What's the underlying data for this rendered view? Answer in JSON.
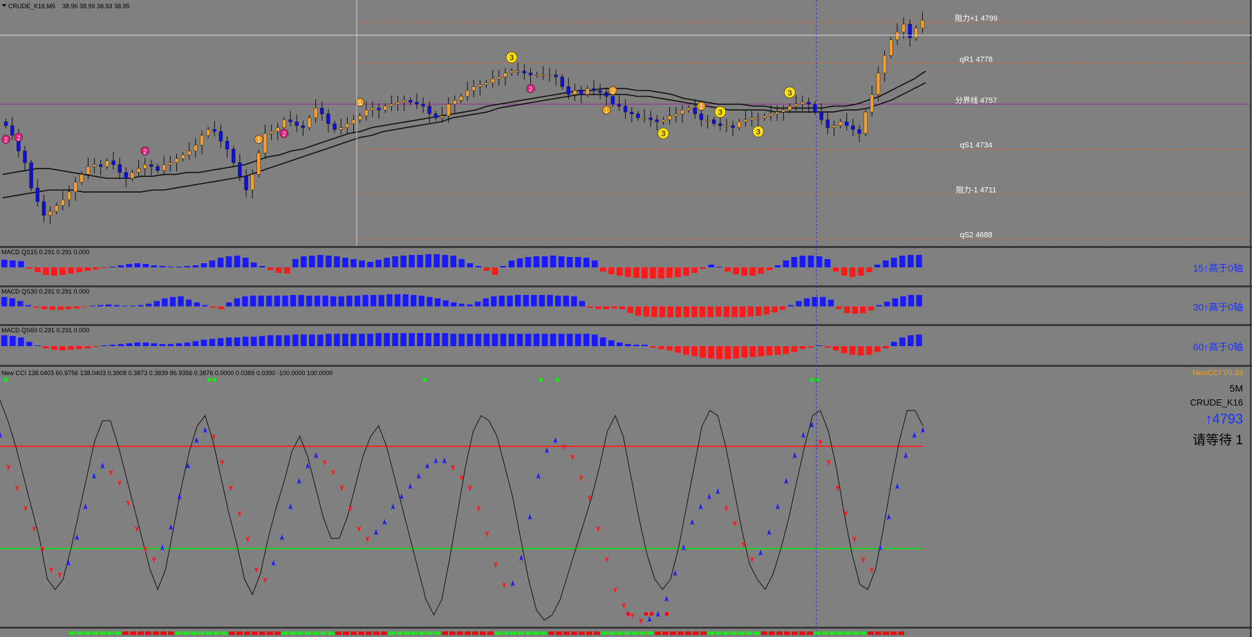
{
  "header": {
    "symbol_line": "CRUDE_K16,M5",
    "ohlc_line": "38.96 38.99 38.93 38.95"
  },
  "colors": {
    "background": "#808080",
    "bull_body": "#f0a030",
    "bear_body": "#1010d8",
    "wick": "#101010",
    "positive_hist": "#1a1aff",
    "negative_hist": "#ff1a1a",
    "level_line_red": "#ff2020",
    "level_line_green": "#20d020",
    "resistance_line": "#c86f3a",
    "mid_line": "#a020a0",
    "dot_green": "#20e020",
    "dot_red": "#e01010",
    "cursor_line": "#1a30ff"
  },
  "chart_data": [
    {
      "type": "line",
      "panel": "price",
      "title": "CRUDE_K16,M5",
      "levels": [
        {
          "name": "阻力+1",
          "value": 4799,
          "text": "阻力+1 4799"
        },
        {
          "name": "qR1",
          "value": 4778,
          "text": "qR1 4778"
        },
        {
          "name": "分界线",
          "value": 4757,
          "text": "分界线 4757"
        },
        {
          "name": "qS1",
          "value": 4734,
          "text": "qS1 4734"
        },
        {
          "name": "阻力-1",
          "value": 4711,
          "text": "阻力-1 4711"
        },
        {
          "name": "qS2",
          "value": 4688,
          "text": "qS2 4688"
        }
      ],
      "ylim": [
        4685,
        4809
      ],
      "price_close": [
        4746,
        4741,
        4733,
        4727,
        4714,
        4707,
        4700,
        4702,
        4705,
        4708,
        4712,
        4717,
        4721,
        4725,
        4726,
        4725,
        4728,
        4726,
        4722,
        4719,
        4722,
        4724,
        4726,
        4725,
        4723,
        4726,
        4727,
        4729,
        4731,
        4733,
        4736,
        4741,
        4744,
        4743,
        4738,
        4734,
        4727,
        4720,
        4713,
        4721,
        4732,
        4742,
        4743,
        4745,
        4749,
        4748,
        4746,
        4745,
        4750,
        4755,
        4752,
        4747,
        4744,
        4745,
        4747,
        4749,
        4751,
        4754,
        4755,
        4754,
        4756,
        4757,
        4758,
        4759,
        4758,
        4757,
        4756,
        4752,
        4750,
        4751,
        4757,
        4759,
        4761,
        4764,
        4766,
        4767,
        4768,
        4770,
        4771,
        4773,
        4774,
        4774,
        4773,
        4772,
        4772,
        4772,
        4772,
        4771,
        4766,
        4762,
        4764,
        4762,
        4765,
        4764,
        4763,
        4761,
        4757,
        4756,
        4753,
        4752,
        4750,
        4750,
        4749,
        4748,
        4749,
        4751,
        4752,
        4754,
        4755,
        4752,
        4749,
        4749,
        4747,
        4746,
        4746,
        4745,
        4748,
        4749,
        4750,
        4750,
        4751,
        4752,
        4753,
        4754,
        4756,
        4757,
        4758,
        4757,
        4753,
        4749,
        4745,
        4746,
        4748,
        4746,
        4744,
        4742,
        4753,
        4762,
        4773,
        4782,
        4790,
        4794,
        4798,
        4791,
        4796,
        4800
      ],
      "ma_fast": [
        4721,
        4722,
        4723,
        4724,
        4724,
        4723,
        4722,
        4721,
        4720,
        4719,
        4719,
        4719,
        4720,
        4720,
        4721,
        4721,
        4722,
        4722,
        4723,
        4724,
        4725,
        4726,
        4728,
        4730,
        4731,
        4733,
        4734,
        4736,
        4738,
        4740,
        4742,
        4743,
        4745,
        4746,
        4747,
        4748,
        4749,
        4750,
        4751,
        4752,
        4753,
        4754,
        4756,
        4757,
        4758,
        4759,
        4760,
        4761,
        4762,
        4763,
        4764,
        4764,
        4765,
        4765,
        4765,
        4764,
        4764,
        4763,
        4762,
        4760,
        4759,
        4758,
        4757,
        4757,
        4757,
        4756,
        4756,
        4755,
        4755,
        4755,
        4755,
        4755,
        4756,
        4756,
        4757,
        4759,
        4761,
        4764,
        4767,
        4770,
        4774
      ],
      "ma_slow": [
        4709,
        4710,
        4711,
        4712,
        4713,
        4713,
        4713,
        4712,
        4712,
        4712,
        4712,
        4712,
        4712,
        4713,
        4713,
        4714,
        4715,
        4716,
        4717,
        4718,
        4719,
        4720,
        4722,
        4724,
        4726,
        4728,
        4730,
        4732,
        4734,
        4736,
        4738,
        4740,
        4741,
        4743,
        4744,
        4745,
        4746,
        4747,
        4748,
        4750,
        4751,
        4752,
        4753,
        4755,
        4756,
        4757,
        4758,
        4759,
        4760,
        4761,
        4762,
        4762,
        4762,
        4762,
        4762,
        4761,
        4761,
        4760,
        4759,
        4758,
        4757,
        4756,
        4755,
        4754,
        4754,
        4754,
        4754,
        4753,
        4753,
        4753,
        4753,
        4753,
        4753,
        4754,
        4754,
        4755,
        4757,
        4759,
        4762,
        4765,
        4768
      ],
      "markers": [
        {
          "label": "2",
          "color": "#e0207a"
        },
        {
          "label": "2",
          "color": "#e0207a"
        },
        {
          "label": "2",
          "color": "#e0207a"
        },
        {
          "label": "2",
          "color": "#e0207a"
        },
        {
          "label": "2",
          "color": "#e0207a"
        },
        {
          "label": "2",
          "color": "#e0207a"
        },
        {
          "label": "1",
          "color": "#f0a020"
        },
        {
          "label": "1",
          "color": "#f0a020"
        },
        {
          "label": "1",
          "color": "#f0a020"
        },
        {
          "label": "1",
          "color": "#f0a020"
        },
        {
          "label": "2",
          "color": "#f0a020"
        },
        {
          "label": "3",
          "color": "#ffe000"
        },
        {
          "label": "3",
          "color": "#ffe000"
        },
        {
          "label": "3",
          "color": "#ffe000"
        },
        {
          "label": "3",
          "color": "#ffe000"
        },
        {
          "label": "3",
          "color": "#ffe000"
        }
      ]
    },
    {
      "type": "bar",
      "panel": "macd",
      "title": "MACD QS15 0.291 0.291 0.000",
      "right_label": "15↑高于0轴",
      "values": [
        0.55,
        0.5,
        0.45,
        -0.1,
        -0.35,
        -0.55,
        -0.6,
        -0.55,
        -0.45,
        -0.35,
        -0.25,
        -0.15,
        -0.05,
        0.05,
        0.15,
        0.25,
        0.3,
        0.25,
        0.15,
        0.1,
        0.05,
        0.05,
        0.1,
        0.15,
        0.3,
        0.5,
        0.7,
        0.8,
        0.85,
        0.7,
        0.35,
        0.1,
        -0.2,
        -0.4,
        -0.45,
        0.6,
        0.8,
        0.85,
        0.9,
        0.85,
        0.8,
        0.7,
        0.6,
        0.5,
        0.4,
        0.55,
        0.7,
        0.8,
        0.85,
        0.9,
        0.9,
        0.95,
        0.95,
        0.9,
        0.85,
        0.6,
        0.3,
        0.1,
        -0.25,
        -0.55,
        0.1,
        0.5,
        0.65,
        0.75,
        0.8,
        0.8,
        0.85,
        0.8,
        0.75,
        0.75,
        0.7,
        0.5,
        -0.3,
        -0.5,
        -0.6,
        -0.7,
        -0.75,
        -0.8,
        -0.8,
        -0.8,
        -0.75,
        -0.7,
        -0.6,
        -0.4,
        -0.1,
        0.2,
        0.05,
        -0.3,
        -0.5,
        -0.6,
        -0.6,
        -0.45,
        -0.2,
        0.15,
        0.5,
        0.75,
        0.85,
        0.85,
        0.8,
        0.6,
        -0.3,
        -0.6,
        -0.7,
        -0.6,
        -0.35,
        0.2,
        0.5,
        0.7,
        0.85,
        0.9,
        0.9
      ]
    },
    {
      "type": "bar",
      "panel": "macd",
      "title": "MACD QS30 0.291 0.291 0.000",
      "right_label": "30↑高于0轴",
      "values": [
        0.7,
        0.6,
        0.4,
        0.1,
        -0.1,
        -0.2,
        -0.25,
        -0.25,
        -0.2,
        -0.15,
        -0.05,
        0.05,
        0.1,
        0.15,
        0.1,
        0.05,
        0.05,
        0.1,
        0.2,
        0.4,
        0.6,
        0.7,
        0.75,
        0.5,
        0.3,
        0.1,
        -0.1,
        -0.2,
        0.3,
        0.6,
        0.75,
        0.8,
        0.8,
        0.8,
        0.8,
        0.8,
        0.85,
        0.85,
        0.8,
        0.8,
        0.8,
        0.75,
        0.75,
        0.8,
        0.8,
        0.85,
        0.85,
        0.85,
        0.9,
        0.9,
        0.9,
        0.85,
        0.8,
        0.7,
        0.6,
        0.45,
        0.3,
        0.2,
        0.15,
        0.35,
        0.6,
        0.75,
        0.8,
        0.8,
        0.85,
        0.85,
        0.85,
        0.85,
        0.85,
        0.8,
        0.8,
        0.75,
        0.4,
        -0.1,
        -0.2,
        -0.2,
        -0.15,
        -0.2,
        -0.5,
        -0.7,
        -0.75,
        -0.8,
        -0.8,
        -0.8,
        -0.8,
        -0.8,
        -0.8,
        -0.8,
        -0.8,
        -0.75,
        -0.8,
        -0.8,
        -0.8,
        -0.75,
        -0.7,
        -0.6,
        -0.45,
        -0.25,
        0.1,
        0.4,
        0.6,
        0.7,
        0.7,
        0.5,
        -0.2,
        -0.5,
        -0.55,
        -0.5,
        -0.3,
        0.1,
        0.35,
        0.6,
        0.75,
        0.85,
        0.85
      ]
    },
    {
      "type": "bar",
      "panel": "macd",
      "title": "MACD QS60 0.291 0.291 0.000",
      "right_label": "60↑高于0轴",
      "values": [
        0.75,
        0.7,
        0.6,
        0.3,
        0.05,
        -0.15,
        -0.25,
        -0.3,
        -0.25,
        -0.2,
        -0.15,
        -0.05,
        0.05,
        0.1,
        0.15,
        0.2,
        0.25,
        0.25,
        0.2,
        0.15,
        0.15,
        0.2,
        0.25,
        0.35,
        0.45,
        0.5,
        0.55,
        0.6,
        0.6,
        0.65,
        0.65,
        0.7,
        0.75,
        0.75,
        0.75,
        0.8,
        0.8,
        0.8,
        0.8,
        0.85,
        0.85,
        0.85,
        0.85,
        0.85,
        0.85,
        0.9,
        0.9,
        0.9,
        0.9,
        0.9,
        0.9,
        0.9,
        0.9,
        0.9,
        0.85,
        0.85,
        0.85,
        0.85,
        0.85,
        0.85,
        0.85,
        0.85,
        0.85,
        0.85,
        0.85,
        0.85,
        0.85,
        0.85,
        0.85,
        0.85,
        0.85,
        0.8,
        0.6,
        0.4,
        0.25,
        0.15,
        0.1,
        0.1,
        -0.1,
        -0.2,
        -0.3,
        -0.45,
        -0.6,
        -0.7,
        -0.8,
        -0.85,
        -0.9,
        -0.9,
        -0.85,
        -0.8,
        -0.75,
        -0.7,
        -0.65,
        -0.6,
        -0.55,
        -0.4,
        -0.2,
        -0.1,
        0.05,
        -0.1,
        -0.3,
        -0.5,
        -0.6,
        -0.65,
        -0.6,
        -0.4,
        -0.15,
        0.3,
        0.6,
        0.75,
        0.8
      ]
    },
    {
      "type": "line",
      "panel": "cci",
      "title": "New CCI 138.0403 60.9756 138.0403 0.3908 0.3873 0.3839 86.9356 0.3876 0.0000 0.0389 0.0390 -100.0000 100.0000",
      "right_title": "NewCCI V0.33",
      "timeframe": "5M",
      "symbol": "CRUDE_K16",
      "price_text": "↑4793",
      "status_text": "请等待 1",
      "levels": [
        100,
        -100
      ],
      "ylim": [
        -250,
        250
      ],
      "series": [
        {
          "values": [
            120,
            60,
            20,
            -20,
            -60,
            -100,
            -140,
            -150,
            -130,
            -80,
            -20,
            40,
            60,
            50,
            30,
            -10,
            -60,
            -100,
            -120,
            -100,
            -60,
            0,
            60,
            110,
            130,
            120,
            70,
            20,
            -30,
            -80,
            -140,
            -160,
            -130,
            -80,
            -20,
            30,
            60,
            80,
            70,
            50,
            20,
            -20,
            -60,
            -80,
            -70,
            -50,
            -20,
            0,
            20,
            40,
            60,
            70,
            70,
            60,
            40,
            20,
            -20,
            -70,
            -130,
            -170,
            -170,
            -120,
            -40,
            40,
            90,
            110,
            100,
            80,
            40,
            0,
            -60,
            -120,
            -180,
            -210,
            -230,
            -240,
            -240,
            -230,
            -200,
            -150,
            -100,
            -50,
            -20,
            0,
            10,
            -20,
            -50,
            -90,
            -120,
            -110,
            -70,
            -20,
            30,
            80,
            120,
            140,
            110,
            70,
            20,
            -30,
            -80,
            -120,
            -140,
            -100,
            -40,
            20,
            80,
            120,
            130
          ]
        },
        {
          "values": [
            190,
            150,
            100,
            40,
            -20,
            -80,
            -160,
            -180,
            -160,
            -100,
            -30,
            40,
            110,
            150,
            150,
            100,
            40,
            -20,
            -80,
            -140,
            -180,
            -140,
            -60,
            20,
            90,
            140,
            160,
            110,
            40,
            -30,
            -90,
            -160,
            -190,
            -150,
            -80,
            -20,
            30,
            90,
            120,
            80,
            20,
            -40,
            -80,
            -80,
            -40,
            20,
            80,
            120,
            140,
            100,
            40,
            -20,
            -80,
            -140,
            -200,
            -230,
            -200,
            -120,
            -30,
            60,
            130,
            160,
            150,
            120,
            60,
            0,
            -80,
            -160,
            -220,
            -240,
            -230,
            -200,
            -150,
            -100,
            -50,
            0,
            60,
            130,
            160,
            120,
            40,
            -40,
            -110,
            -160,
            -180,
            -160,
            -100,
            -20,
            60,
            140,
            170,
            160,
            100,
            20,
            -60,
            -130,
            -160,
            -180,
            -150,
            -100,
            -40,
            30,
            100,
            160,
            170,
            130,
            60,
            -30,
            -110,
            -170,
            -180,
            -140,
            -60,
            30,
            110,
            170,
            170,
            140
          ]
        }
      ],
      "signal_dots_top": [
        "green",
        "green",
        "green",
        "green",
        "green",
        "green",
        "green",
        "green"
      ],
      "signal_dots_bottom": [
        "red",
        "red",
        "red",
        "red"
      ]
    }
  ]
}
